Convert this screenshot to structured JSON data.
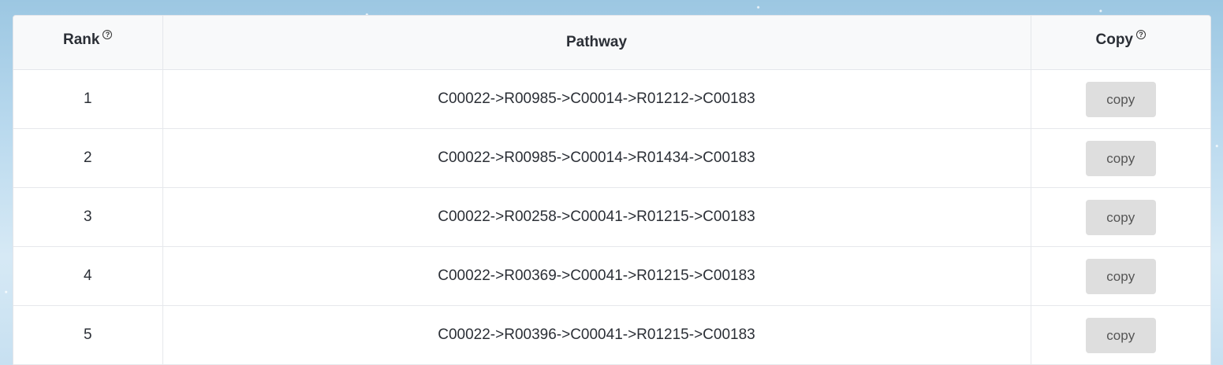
{
  "table": {
    "headers": {
      "rank": "Rank",
      "pathway": "Pathway",
      "copy": "Copy",
      "help_symbol": "?"
    },
    "copy_button_label": "copy",
    "rows": [
      {
        "rank": "1",
        "pathway": "C00022->R00985->C00014->R01212->C00183"
      },
      {
        "rank": "2",
        "pathway": "C00022->R00985->C00014->R01434->C00183"
      },
      {
        "rank": "3",
        "pathway": "C00022->R00258->C00041->R01215->C00183"
      },
      {
        "rank": "4",
        "pathway": "C00022->R00369->C00041->R01215->C00183"
      },
      {
        "rank": "5",
        "pathway": "C00022->R00396->C00041->R01215->C00183"
      }
    ]
  },
  "icons": {
    "rank_help": "question-circle-icon",
    "copy_help": "question-circle-icon"
  }
}
